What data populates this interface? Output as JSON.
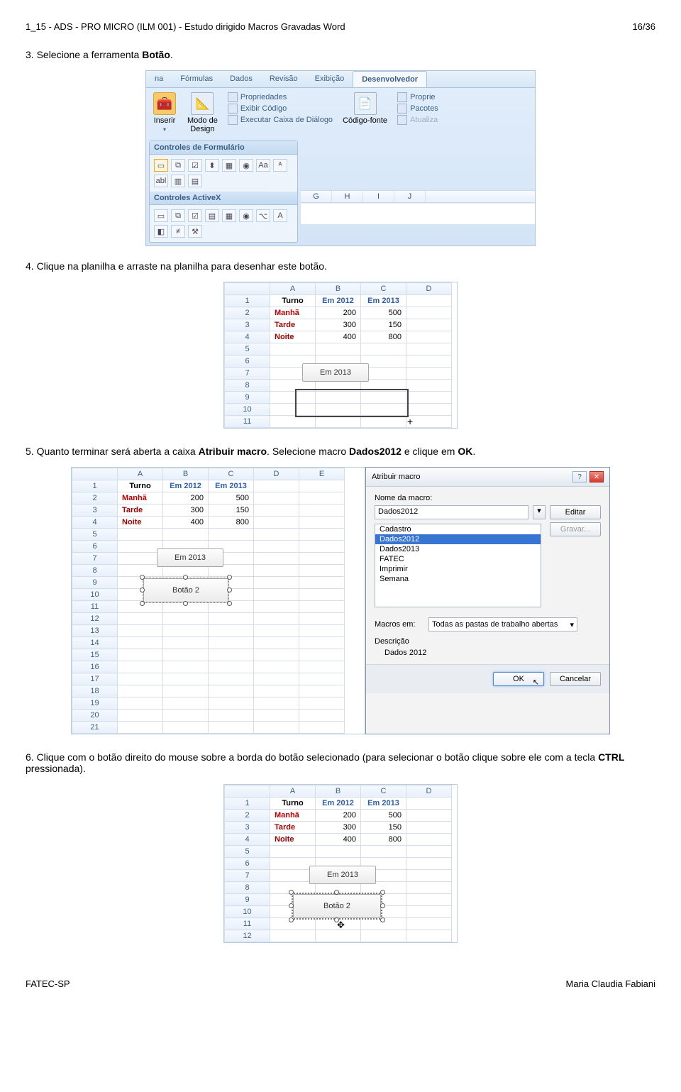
{
  "header": {
    "left": "1_15 - ADS - PRO MICRO (ILM 001) - Estudo dirigido Macros Gravadas Word",
    "right": "16/36"
  },
  "steps": {
    "s3_prefix": "3.  Selecione a ferramenta ",
    "s3_bold": "Botão",
    "s3_suffix": ".",
    "s4": "4.  Clique na planilha e arraste na planilha para desenhar este botão.",
    "s5_prefix": "5.  Quanto terminar será aberta a caixa ",
    "s5_bold1": "Atribuir macro",
    "s5_mid": ". Selecione macro ",
    "s5_bold2": "Dados2012",
    "s5_mid2": " e clique em ",
    "s5_bold3": "OK",
    "s5_suffix": ".",
    "s6_prefix": "6.  Clique com o botão direito do mouse sobre a borda do botão selecionado (para selecionar o botão clique sobre ele com a tecla ",
    "s6_bold": "CTRL",
    "s6_suffix": " pressionada)."
  },
  "ribbon": {
    "tabs": [
      "na",
      "Fórmulas",
      "Dados",
      "Revisão",
      "Exibição",
      "Desenvolvedor"
    ],
    "inserir": "Inserir",
    "modo": "Modo de\nDesign",
    "props": "Propriedades",
    "exibir": "Exibir Código",
    "exec": "Executar Caixa de Diálogo",
    "codigofonte": "Código-fonte",
    "proprie": "Proprie",
    "pacotes": "Pacotes",
    "atualiza": "Atualiza",
    "form": "Controles de Formulário",
    "activex": "Controles ActiveX",
    "form_icons": [
      "▭",
      "⧉",
      "☑",
      "⬍",
      "▦",
      "◉",
      "Aa",
      "ᴬ",
      "abl",
      "▥",
      "▤"
    ],
    "ax_icons": [
      "▭",
      "⧉",
      "☑",
      "▤",
      "▦",
      "◉",
      "⌥",
      "A",
      "◧",
      "≠",
      "⚒"
    ],
    "cols": [
      "G",
      "H",
      "I",
      "J"
    ]
  },
  "table_small": {
    "cols": [
      "",
      "A",
      "B",
      "C",
      "D"
    ],
    "rows": [
      [
        "1",
        "Turno",
        "Em 2012",
        "Em 2013",
        ""
      ],
      [
        "2",
        "Manhã",
        "200",
        "500",
        ""
      ],
      [
        "3",
        "Tarde",
        "300",
        "150",
        ""
      ],
      [
        "4",
        "Noite",
        "400",
        "800",
        ""
      ],
      [
        "5",
        "",
        "",
        "",
        ""
      ],
      [
        "6",
        "",
        "",
        "",
        ""
      ],
      [
        "7",
        "",
        "",
        "",
        ""
      ],
      [
        "8",
        "",
        "",
        "",
        ""
      ],
      [
        "9",
        "",
        "",
        "",
        ""
      ],
      [
        "10",
        "",
        "",
        "",
        ""
      ],
      [
        "11",
        "",
        "",
        "",
        ""
      ]
    ],
    "float_label": "Em 2013"
  },
  "table_wide": {
    "cols": [
      "",
      "A",
      "B",
      "C",
      "D",
      "E"
    ],
    "rows": [
      [
        "1",
        "Turno",
        "Em 2012",
        "Em 2013",
        "",
        ""
      ],
      [
        "2",
        "Manhã",
        "200",
        "500",
        "",
        ""
      ],
      [
        "3",
        "Tarde",
        "300",
        "150",
        "",
        ""
      ],
      [
        "4",
        "Noite",
        "400",
        "800",
        "",
        ""
      ],
      [
        "5",
        "",
        "",
        "",
        "",
        ""
      ],
      [
        "6",
        "",
        "",
        "",
        "",
        ""
      ],
      [
        "7",
        "",
        "",
        "",
        "",
        ""
      ],
      [
        "8",
        "",
        "",
        "",
        "",
        ""
      ],
      [
        "9",
        "",
        "",
        "",
        "",
        ""
      ],
      [
        "10",
        "",
        "",
        "",
        "",
        ""
      ],
      [
        "11",
        "",
        "",
        "",
        "",
        ""
      ],
      [
        "12",
        "",
        "",
        "",
        "",
        ""
      ],
      [
        "13",
        "",
        "",
        "",
        "",
        ""
      ],
      [
        "14",
        "",
        "",
        "",
        "",
        ""
      ],
      [
        "15",
        "",
        "",
        "",
        "",
        ""
      ],
      [
        "16",
        "",
        "",
        "",
        "",
        ""
      ],
      [
        "17",
        "",
        "",
        "",
        "",
        ""
      ],
      [
        "18",
        "",
        "",
        "",
        "",
        ""
      ],
      [
        "19",
        "",
        "",
        "",
        "",
        ""
      ],
      [
        "20",
        "",
        "",
        "",
        "",
        ""
      ],
      [
        "21",
        "",
        "",
        "",
        "",
        ""
      ]
    ],
    "float_label": "Em 2013",
    "button_label": "Botão 2"
  },
  "dialog": {
    "title": "Atribuir macro",
    "name_label": "Nome da macro:",
    "name_value": "Dados2012",
    "list": [
      "Cadastro",
      "Dados2012",
      "Dados2013",
      "FATEC",
      "Imprimir",
      "Semana"
    ],
    "selected": "Dados2012",
    "edit_btn": "Editar",
    "record_btn": "Gravar...",
    "macros_em": "Macros em:",
    "macros_em_value": "Todas as pastas de trabalho abertas",
    "descricao": "Descrição",
    "descricao_value": "Dados 2012",
    "ok": "OK",
    "cancel": "Cancelar"
  },
  "table_last": {
    "cols": [
      "",
      "A",
      "B",
      "C",
      "D"
    ],
    "rows": [
      [
        "1",
        "Turno",
        "Em 2012",
        "Em 2013",
        ""
      ],
      [
        "2",
        "Manhã",
        "200",
        "500",
        ""
      ],
      [
        "3",
        "Tarde",
        "300",
        "150",
        ""
      ],
      [
        "4",
        "Noite",
        "400",
        "800",
        ""
      ],
      [
        "5",
        "",
        "",
        "",
        ""
      ],
      [
        "6",
        "",
        "",
        "",
        ""
      ],
      [
        "7",
        "",
        "",
        "",
        ""
      ],
      [
        "8",
        "",
        "",
        "",
        ""
      ],
      [
        "9",
        "",
        "",
        "",
        ""
      ],
      [
        "10",
        "",
        "",
        "",
        ""
      ],
      [
        "11",
        "",
        "",
        "",
        ""
      ],
      [
        "12",
        "",
        "",
        "",
        ""
      ]
    ],
    "float_label": "Em 2013",
    "button_label": "Botão 2"
  },
  "footer": {
    "left": "FATEC-SP",
    "right": "Maria Claudia Fabiani"
  }
}
